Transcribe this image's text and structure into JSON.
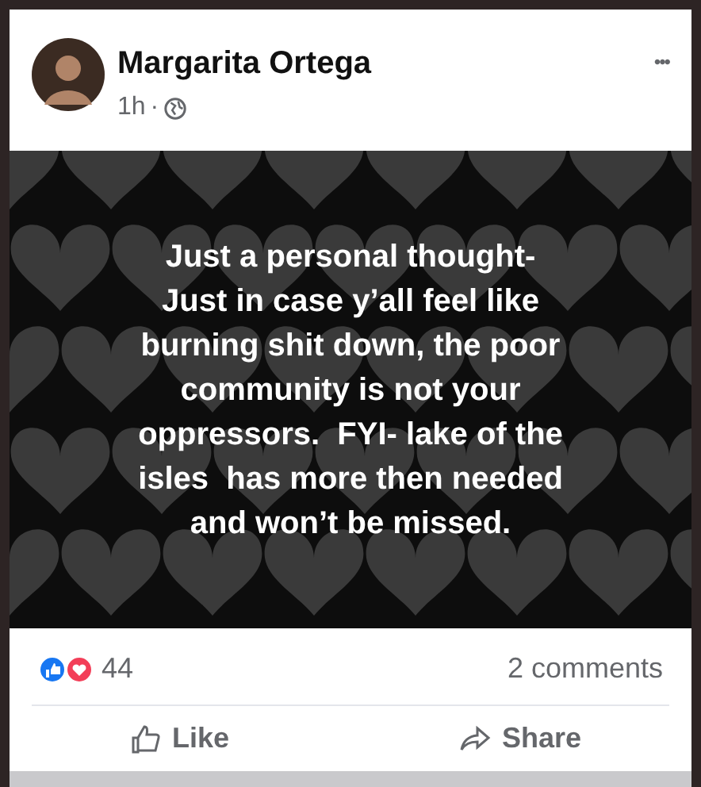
{
  "post": {
    "author": "Margarita Ortega",
    "time": "1h",
    "separator": "·",
    "menu": "•••",
    "text_lines": [
      "Just a personal thought-",
      "Just in case y’all feel like",
      "burning shit down, the poor",
      "community is not your",
      "oppressors.  FYI- lake of the",
      "isles  has more then needed",
      "and won’t be missed."
    ],
    "reaction_count": "44",
    "comments": "2 comments",
    "actions": [
      {
        "kind": "like",
        "label": "Like"
      },
      {
        "kind": "share",
        "label": "Share"
      }
    ]
  }
}
